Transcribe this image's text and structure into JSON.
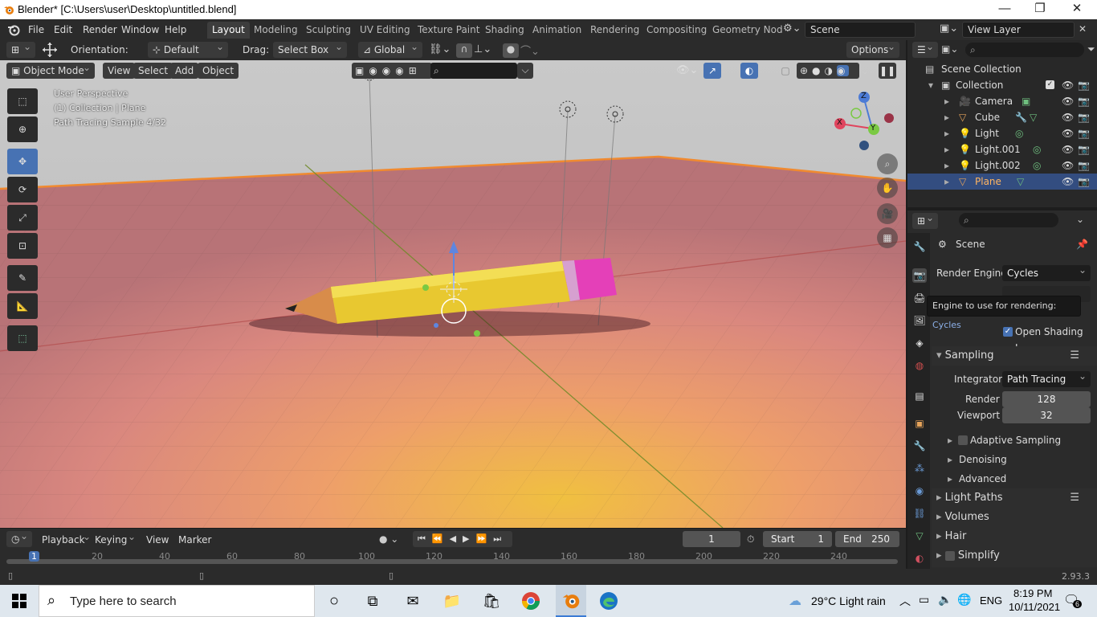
{
  "window": {
    "title": "Blender* [C:\\Users\\user\\Desktop\\untitled.blend]",
    "minimize": "—",
    "maximize": "❐",
    "close": "✕"
  },
  "menu": [
    "File",
    "Edit",
    "Render",
    "Window",
    "Help"
  ],
  "workspaces": {
    "tabs": [
      "Layout",
      "Modeling",
      "Sculpting",
      "UV Editing",
      "Texture Paint",
      "Shading",
      "Animation",
      "Rendering",
      "Compositing",
      "Geometry Nod"
    ],
    "active": "Layout",
    "scene": "Scene",
    "view_layer": "View Layer"
  },
  "tool_header": {
    "orientation_label": "Orientation:",
    "orientation_value": "Default",
    "drag_label": "Drag:",
    "drag_value": "Select Box",
    "transform_orientation": "Global",
    "options": "Options"
  },
  "viewport_header": {
    "mode": "Object Mode",
    "menus": [
      "View",
      "Select",
      "Add",
      "Object"
    ]
  },
  "viewport": {
    "info_line1": "User Perspective",
    "info_line2": "(1) Collection | Plane",
    "info_line3": "Path Tracing Sample 4/32",
    "gizmo_x": "X",
    "gizmo_y": "Y",
    "gizmo_z": "Z"
  },
  "timeline": {
    "menus": [
      "Playback",
      "Keying",
      "View",
      "Marker"
    ],
    "current_frame": "1",
    "start_label": "Start",
    "start": "1",
    "end_label": "End",
    "end": "250",
    "ruler": [
      "1",
      "20",
      "40",
      "60",
      "80",
      "100",
      "120",
      "140",
      "160",
      "180",
      "200",
      "220",
      "240"
    ]
  },
  "outliner": {
    "root": "Scene Collection",
    "collection": "Collection",
    "items": [
      {
        "name": "Camera",
        "icon": "camera-icon",
        "color": "#e5a35a"
      },
      {
        "name": "Cube",
        "icon": "mesh-icon",
        "color": "#e5a35a"
      },
      {
        "name": "Light",
        "icon": "light-icon",
        "color": "#e5a35a"
      },
      {
        "name": "Light.001",
        "icon": "light-icon",
        "color": "#e5a35a"
      },
      {
        "name": "Light.002",
        "icon": "light-icon",
        "color": "#e5a35a"
      },
      {
        "name": "Plane",
        "icon": "mesh-icon",
        "color": "#e5a35a"
      }
    ],
    "selected": "Plane"
  },
  "properties": {
    "context": "Scene",
    "render_engine_label": "Render Engine",
    "render_engine": "Cycles",
    "tooltip_text": "Engine to use for rendering:",
    "tooltip_value": "Cycles",
    "open_shading": "Open Shading L...",
    "sampling": "Sampling",
    "integrator_label": "Integrator",
    "integrator": "Path Tracing",
    "render_label": "Render",
    "render_samples": "128",
    "viewport_label": "Viewport",
    "viewport_samples": "32",
    "adaptive": "Adaptive Sampling",
    "denoising": "Denoising",
    "advanced": "Advanced",
    "light_paths": "Light Paths",
    "volumes": "Volumes",
    "hair": "Hair",
    "simplify": "Simplify"
  },
  "status": {
    "version": "2.93.3"
  },
  "taskbar": {
    "search_placeholder": "Type here to search",
    "weather": "29°C  Light rain",
    "lang": "ENG",
    "time": "8:19 PM",
    "date": "10/11/2021",
    "notifications": "6"
  },
  "colors": {
    "accent": "#4772b3",
    "selection": "#334d80",
    "origin": "#e5a35a"
  }
}
